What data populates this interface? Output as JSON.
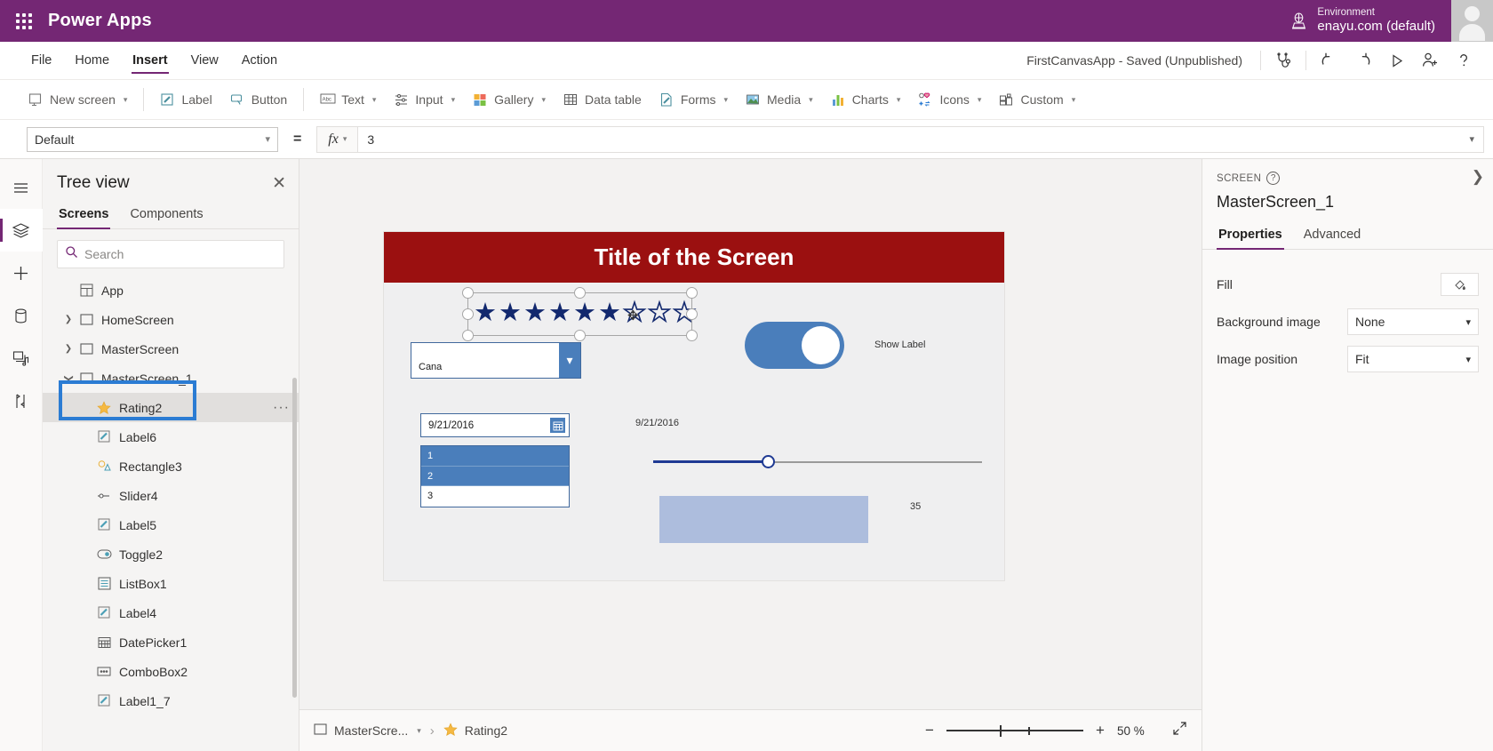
{
  "topbar": {
    "waffle_icon": "app-launcher-icon",
    "brand": "Power Apps",
    "env_icon": "globe-icon",
    "env_label": "Environment",
    "env_name": "enayu.com (default)"
  },
  "menu": {
    "items": [
      {
        "label": "File",
        "active": false
      },
      {
        "label": "Home",
        "active": false
      },
      {
        "label": "Insert",
        "active": true
      },
      {
        "label": "View",
        "active": false
      },
      {
        "label": "Action",
        "active": false
      }
    ],
    "app_status": "FirstCanvasApp - Saved (Unpublished)",
    "actions": [
      {
        "name": "app-checker-icon",
        "title": "App checker"
      },
      {
        "name": "undo-icon",
        "title": "Undo"
      },
      {
        "name": "redo-icon",
        "title": "Redo"
      },
      {
        "name": "preview-play-icon",
        "title": "Preview the app"
      },
      {
        "name": "share-user-icon",
        "title": "Share"
      },
      {
        "name": "help-icon",
        "title": "Help"
      }
    ]
  },
  "ribbon": {
    "items": [
      {
        "label": "New screen",
        "icon": "new-screen-icon",
        "caret": true
      },
      {
        "label": "Label",
        "icon": "label-icon",
        "caret": false
      },
      {
        "label": "Button",
        "icon": "button-icon",
        "caret": false
      },
      {
        "label": "Text",
        "icon": "text-abc-icon",
        "caret": true
      },
      {
        "label": "Input",
        "icon": "input-sliders-icon",
        "caret": true
      },
      {
        "label": "Gallery",
        "icon": "gallery-icon",
        "caret": true
      },
      {
        "label": "Data table",
        "icon": "data-table-icon",
        "caret": false
      },
      {
        "label": "Forms",
        "icon": "forms-icon",
        "caret": true
      },
      {
        "label": "Media",
        "icon": "media-icon",
        "caret": true
      },
      {
        "label": "Charts",
        "icon": "charts-icon",
        "caret": true
      },
      {
        "label": "Icons",
        "icon": "icons-icon",
        "caret": true
      },
      {
        "label": "Custom",
        "icon": "custom-icon",
        "caret": true
      }
    ]
  },
  "formula_bar": {
    "property": "Default",
    "equals": "=",
    "fx_label": "fx",
    "value": "3"
  },
  "rail": {
    "items": [
      {
        "name": "hamburger-menu-icon",
        "selected": false
      },
      {
        "name": "tree-view-layers-icon",
        "selected": true
      },
      {
        "name": "insert-plus-icon",
        "selected": false
      },
      {
        "name": "data-sources-icon",
        "selected": false
      },
      {
        "name": "media-library-icon",
        "selected": false
      },
      {
        "name": "advanced-tools-icon",
        "selected": false
      }
    ]
  },
  "tree": {
    "title": "Tree view",
    "close_icon": "close-icon",
    "tabs": [
      {
        "label": "Screens",
        "active": true
      },
      {
        "label": "Components",
        "active": false
      }
    ],
    "search": {
      "placeholder": "Search",
      "value": "",
      "icon": "search-icon"
    },
    "nodes": [
      {
        "label": "App",
        "icon": "app-icon",
        "level": 0,
        "caret": "",
        "selected": false
      },
      {
        "label": "HomeScreen",
        "icon": "screen-icon",
        "level": 1,
        "caret": "collapsed",
        "selected": false
      },
      {
        "label": "MasterScreen",
        "icon": "screen-icon",
        "level": 1,
        "caret": "collapsed",
        "selected": false
      },
      {
        "label": "MasterScreen_1",
        "icon": "screen-icon",
        "level": 1,
        "caret": "expanded",
        "selected": false
      },
      {
        "label": "Rating2",
        "icon": "star-icon",
        "level": 2,
        "caret": "",
        "selected": true
      },
      {
        "label": "Label6",
        "icon": "label-icon",
        "level": 2,
        "caret": "",
        "selected": false
      },
      {
        "label": "Rectangle3",
        "icon": "shapes-icon",
        "level": 2,
        "caret": "",
        "selected": false
      },
      {
        "label": "Slider4",
        "icon": "slider-icon",
        "level": 2,
        "caret": "",
        "selected": false
      },
      {
        "label": "Label5",
        "icon": "label-icon",
        "level": 2,
        "caret": "",
        "selected": false
      },
      {
        "label": "Toggle2",
        "icon": "toggle-icon",
        "level": 2,
        "caret": "",
        "selected": false
      },
      {
        "label": "ListBox1",
        "icon": "listbox-icon",
        "level": 2,
        "caret": "",
        "selected": false
      },
      {
        "label": "Label4",
        "icon": "label-icon",
        "level": 2,
        "caret": "",
        "selected": false
      },
      {
        "label": "DatePicker1",
        "icon": "calendar-icon",
        "level": 2,
        "caret": "",
        "selected": false
      },
      {
        "label": "ComboBox2",
        "icon": "combobox-icon",
        "level": 2,
        "caret": "",
        "selected": false
      },
      {
        "label": "Label1_7",
        "icon": "label-icon",
        "level": 2,
        "caret": "",
        "selected": false
      }
    ],
    "more_options_icon": "more-options-icon"
  },
  "canvas": {
    "screen_title": "Title of the Screen",
    "rating": {
      "filled": 6,
      "total": 9,
      "filled_color": "#12286e"
    },
    "combobox": {
      "value": "Cana",
      "chevron_icon": "chevron-down-icon"
    },
    "toggle": {
      "state": "on",
      "color": "#4a7ebb"
    },
    "toggle_label": "Show Label",
    "datepicker": {
      "value": "9/21/2016",
      "icon": "calendar-icon"
    },
    "date_label": "9/21/2016",
    "bool_label": "true",
    "listbox": {
      "items": [
        {
          "label": "1",
          "selected": true
        },
        {
          "label": "2",
          "selected": true
        },
        {
          "label": "3",
          "selected": false
        }
      ]
    },
    "slider": {
      "value": 35,
      "min": 0,
      "max": 100
    },
    "slider_label": "35",
    "rectangle_color": "#adbddd",
    "title_bar_color": "#9b1010"
  },
  "statusbar": {
    "screen_name": "MasterScre...",
    "screen_icon": "screen-icon",
    "chevron_icon": "chevron-down-icon",
    "breadcrumb_sep": "›",
    "control_name": "Rating2",
    "control_icon": "star-icon",
    "zoom_out_icon": "−",
    "zoom_in_icon": "+",
    "zoom_value": "50",
    "zoom_unit": "%",
    "fit_icon": "fit-screen-icon"
  },
  "properties": {
    "kind": "SCREEN",
    "help_icon": "help-circle-icon",
    "name": "MasterScreen_1",
    "collapse_icon": "chevron-right-icon",
    "tabs": [
      {
        "label": "Properties",
        "active": true
      },
      {
        "label": "Advanced",
        "active": false
      }
    ],
    "rows": [
      {
        "label": "Fill",
        "type": "color",
        "value": ""
      },
      {
        "label": "Background image",
        "type": "select",
        "value": "None"
      },
      {
        "label": "Image position",
        "type": "select",
        "value": "Fit"
      }
    ]
  },
  "colors": {
    "brand_purple": "#742774",
    "accent_blue": "#2b7cd3",
    "title_red": "#9b1010"
  }
}
